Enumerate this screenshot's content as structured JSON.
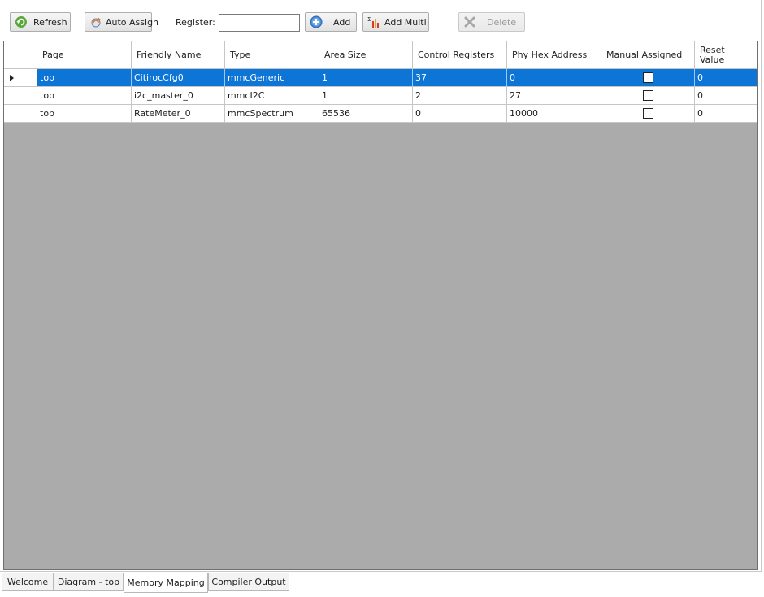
{
  "toolbar": {
    "refresh_label": "Refresh",
    "auto_assign_label": "Auto Assign",
    "register_label": "Register:",
    "register_value": "",
    "add_label": "Add",
    "add_multi_label": "Add Multi",
    "delete_label": "Delete"
  },
  "table": {
    "columns": [
      "Page",
      "Friendly Name",
      "Type",
      "Area Size",
      "Control Registers",
      "Phy Hex Address",
      "Manual Assigned",
      "Reset Value"
    ],
    "rows": [
      {
        "page": "top",
        "friendly_name": "CitirocCfg0",
        "type": "mmcGeneric",
        "area_size": "1",
        "control_registers": "37",
        "phy_hex_address": "0",
        "manual_assigned": false,
        "reset_value": "0",
        "selected": true
      },
      {
        "page": "top",
        "friendly_name": "i2c_master_0",
        "type": "mmcI2C",
        "area_size": "1",
        "control_registers": "2",
        "phy_hex_address": "27",
        "manual_assigned": false,
        "reset_value": "0",
        "selected": false
      },
      {
        "page": "top",
        "friendly_name": "RateMeter_0",
        "type": "mmcSpectrum",
        "area_size": "65536",
        "control_registers": "0",
        "phy_hex_address": "10000",
        "manual_assigned": false,
        "reset_value": "0",
        "selected": false
      }
    ]
  },
  "tabs": [
    {
      "label": "Welcome",
      "active": false
    },
    {
      "label": "Diagram - top",
      "active": false
    },
    {
      "label": "Memory Mapping",
      "active": true
    },
    {
      "label": "Compiler Output",
      "active": false
    }
  ],
  "colors": {
    "selection": "#0c75d6",
    "grid_background": "#ababab"
  },
  "icons": {
    "refresh": "refresh-icon",
    "auto_assign": "auto-assign-icon",
    "add": "add-circle-icon",
    "add_multi": "add-multi-icon",
    "delete": "delete-x-icon"
  }
}
